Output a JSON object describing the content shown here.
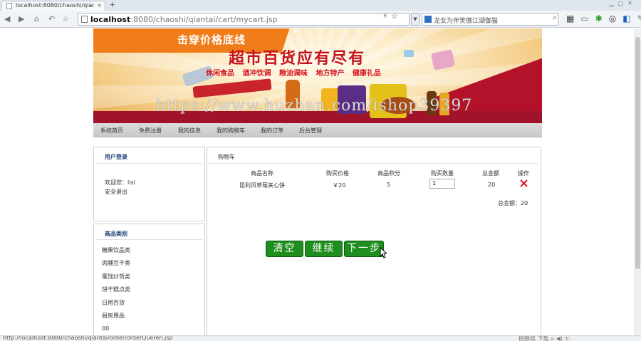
{
  "browser": {
    "tab_title": "localhost:8080/chaoshi/qian",
    "tab_close": "×",
    "new_tab": "+",
    "url_host": "localhost",
    "url_rest": ":8080/chaoshi/qiantai/cart/mycart.jsp",
    "search_placeholder": "龙女为伴笑傲江湖御猫",
    "status_url": "http://localhost:8080/chaoshi/qiantai/order/orderQueren.jsp",
    "status_right": "拍摄链  下载  ⌂  ◀)  Ⓔ"
  },
  "banner": {
    "slogan": "击穿价格底线",
    "headline": "超市百货应有尽有",
    "categories": "休闲食品 酒冲饮调 粮油调味 地方特产 健康礼品",
    "watermark": "https://www.huzhan.com/ishop39397"
  },
  "menu": {
    "items": [
      "系统首页",
      "免费注册",
      "我的信息",
      "我的购物车",
      "我的订单",
      "后台管理"
    ]
  },
  "login": {
    "title": "用户登录",
    "welcome": "欢迎您：lisi",
    "logout": "安全退出"
  },
  "categories": {
    "title": "商品类别",
    "items": [
      "糖果饮品类",
      "肉脯豆干类",
      "蜜饯炒货类",
      "饼干糕点类",
      "日用百货",
      "厨房用品",
      "00"
    ]
  },
  "cart": {
    "title": "购物车",
    "headers": [
      "商品名称",
      "购买价格",
      "商品积分",
      "购买数量",
      "总金额",
      "操作"
    ],
    "row": {
      "name": "昆利风草莓夹心饼",
      "price": "￥20",
      "points": "5",
      "quantity": "1",
      "total": "20"
    },
    "grand_total": "总金额：20",
    "buttons": {
      "clear": "清空",
      "continue": "继续",
      "next": "下一步"
    }
  },
  "colors": {
    "accent_green": "#1e8e1e",
    "delete_red": "#e0141e",
    "panel_title_blue": "#1a3e78"
  }
}
